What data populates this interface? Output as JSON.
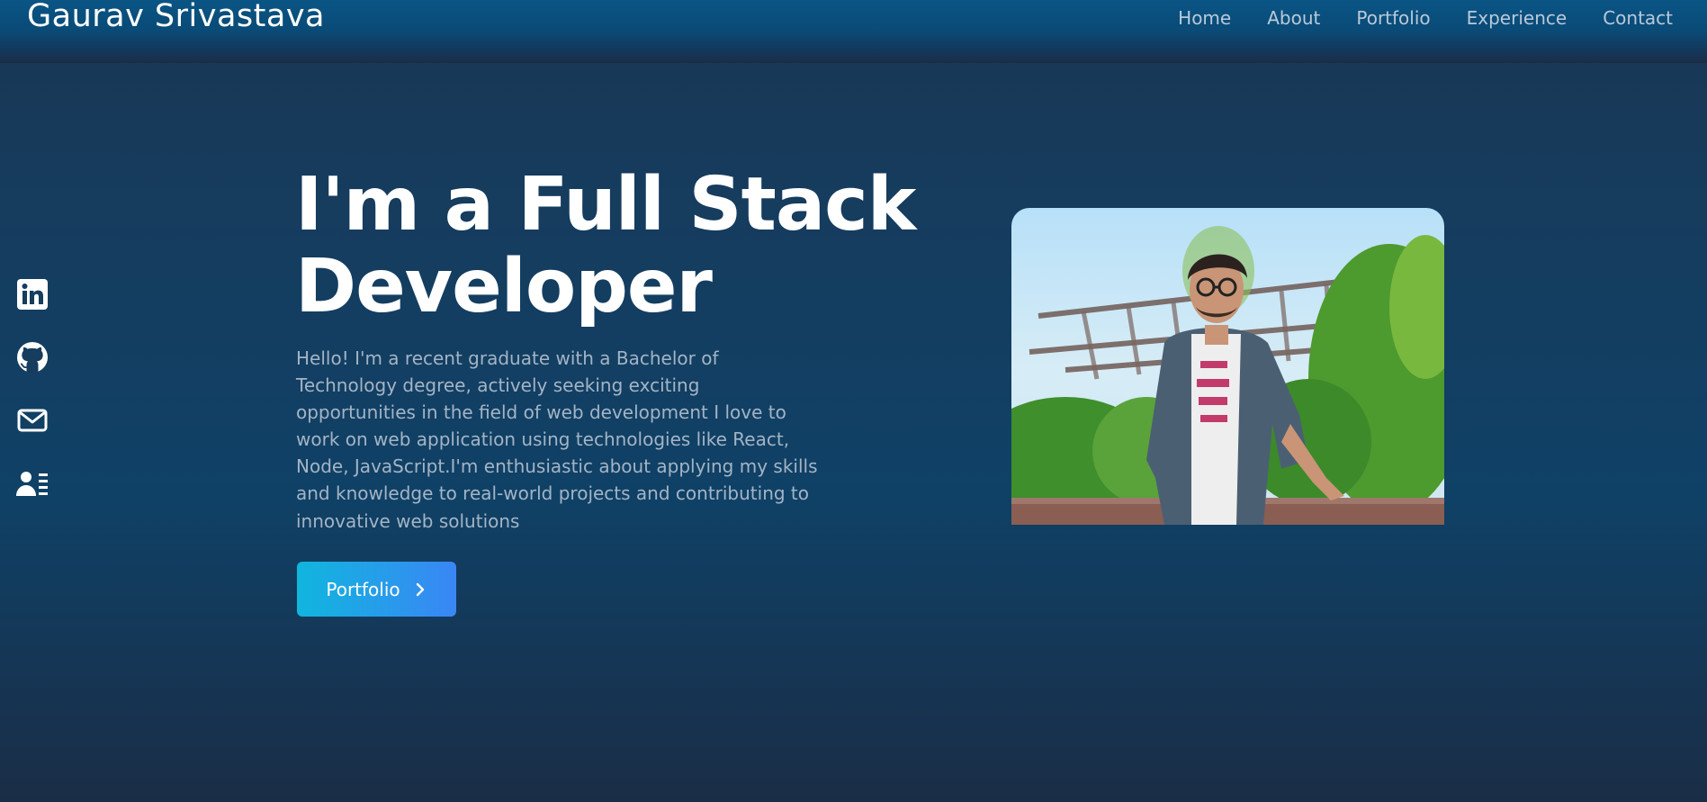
{
  "header": {
    "brand": "Gaurav Srivastava",
    "nav": [
      "Home",
      "About",
      "Portfolio",
      "Experience",
      "Contact"
    ]
  },
  "social": [
    {
      "icon": "linkedin-icon"
    },
    {
      "icon": "github-icon"
    },
    {
      "icon": "mail-icon"
    },
    {
      "icon": "resume-icon"
    }
  ],
  "hero": {
    "title_line1": "I'm a Full Stack",
    "title_line2": "Developer",
    "description": "Hello! I'm a recent graduate with a Bachelor of Technology degree, actively seeking exciting opportunities in the field of web development I love to work on web application using technologies like React, Node, JavaScript.I'm enthusiastic about applying my skills and knowledge to real-world projects and contributing to innovative web solutions",
    "button_label": "Portfolio",
    "button_icon": "chevron-right-icon"
  },
  "colors": {
    "accent_start": "#10b6de",
    "accent_end": "#3a86f5",
    "header": "#0a5585",
    "background": "#163c5e"
  }
}
